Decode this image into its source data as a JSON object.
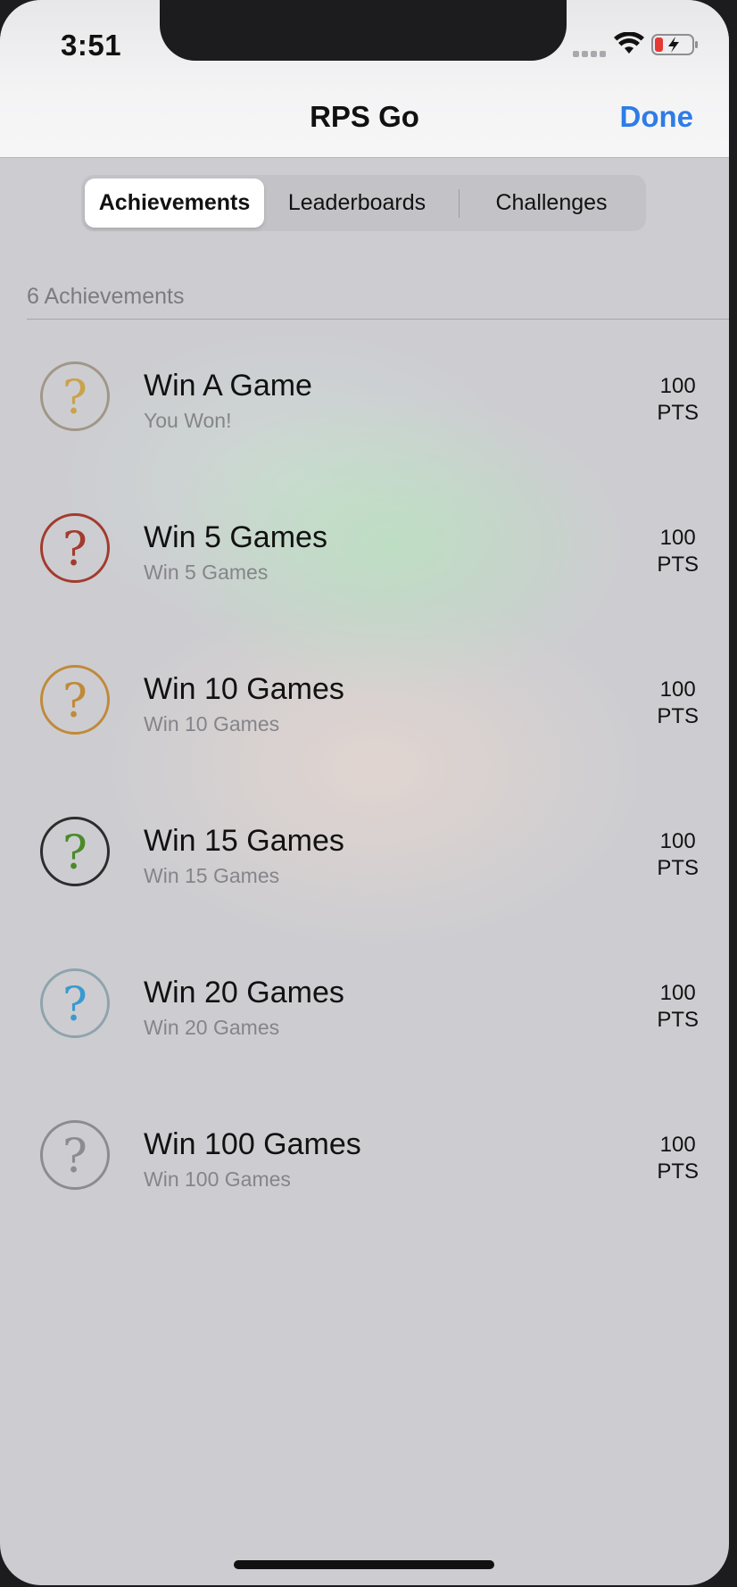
{
  "status_bar": {
    "time": "3:51"
  },
  "nav": {
    "title": "RPS Go",
    "done_label": "Done"
  },
  "segments": [
    {
      "label": "Achievements",
      "active": true
    },
    {
      "label": "Leaderboards",
      "active": false
    },
    {
      "label": "Challenges",
      "active": false
    }
  ],
  "section": {
    "title": "6 Achievements"
  },
  "achievements": [
    {
      "title": "Win A Game",
      "subtitle": "You Won!",
      "points": "100",
      "points_unit": "PTS",
      "badge_color": "#a09788",
      "glyph_color": "#c9a24a",
      "badge_icon": "question-mark-badge-icon"
    },
    {
      "title": "Win 5 Games",
      "subtitle": "Win 5 Games",
      "points": "100",
      "points_unit": "PTS",
      "badge_color": "#a23b2e",
      "glyph_color": "#a23b2e",
      "badge_icon": "question-mark-badge-icon"
    },
    {
      "title": "Win 10 Games",
      "subtitle": "Win 10 Games",
      "points": "100",
      "points_unit": "PTS",
      "badge_color": "#c08a3a",
      "glyph_color": "#c08a3a",
      "badge_icon": "question-mark-badge-icon"
    },
    {
      "title": "Win 15 Games",
      "subtitle": "Win 15 Games",
      "points": "100",
      "points_unit": "PTS",
      "badge_color": "#2c2c2c",
      "glyph_color": "#4b8a2a",
      "badge_icon": "question-mark-badge-icon"
    },
    {
      "title": "Win 20 Games",
      "subtitle": "Win 20 Games",
      "points": "100",
      "points_unit": "PTS",
      "badge_color": "#8fa4ad",
      "glyph_color": "#3a9ad0",
      "badge_icon": "question-mark-badge-icon"
    },
    {
      "title": "Win 100 Games",
      "subtitle": "Win 100 Games",
      "points": "100",
      "points_unit": "PTS",
      "badge_color": "#8c8c8e",
      "glyph_color": "#8c8c8e",
      "badge_icon": "question-mark-badge-icon"
    }
  ],
  "colors": {
    "accent": "#2f7ce6",
    "background": "#cdcdd1"
  }
}
